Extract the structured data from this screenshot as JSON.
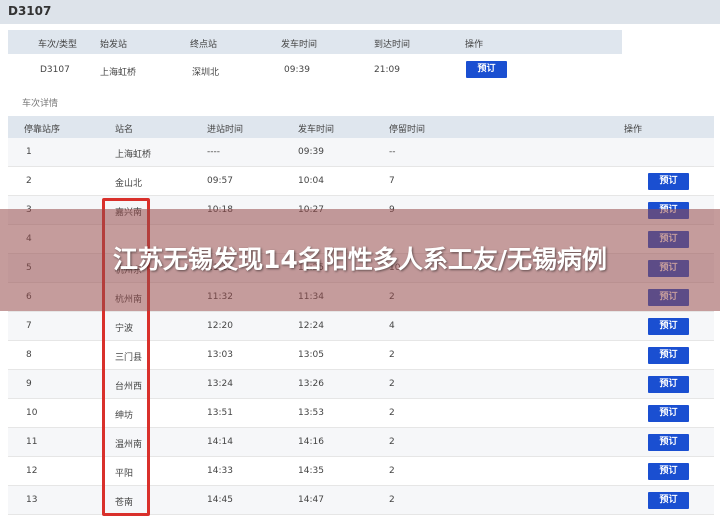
{
  "title": "D3107",
  "summary": {
    "headers": [
      "车次/类型",
      "始发站",
      "终点站",
      "发车时间",
      "到达时间",
      "操作"
    ],
    "row": {
      "train": "D3107",
      "from": "上海虹桥",
      "to": "深圳北",
      "depart": "09:39",
      "arrive": "21:09",
      "action": "预订"
    }
  },
  "section_title": "车次详情",
  "detail": {
    "headers": [
      "停靠站序",
      "站名",
      "进站时间",
      "发车时间",
      "停留时间",
      "操作"
    ],
    "rows": [
      {
        "seq": "1",
        "station": "上海虹桥",
        "arrive": "----",
        "depart": "09:39",
        "stay": "--",
        "action": ""
      },
      {
        "seq": "2",
        "station": "金山北",
        "arrive": "09:57",
        "depart": "10:04",
        "stay": "7",
        "action": "预订"
      },
      {
        "seq": "3",
        "station": "嘉兴南",
        "arrive": "10:18",
        "depart": "10:27",
        "stay": "9",
        "action": "预订"
      },
      {
        "seq": "4",
        "station": "",
        "arrive": "",
        "depart": "",
        "stay": "",
        "action": "预订"
      },
      {
        "seq": "5",
        "station": "杭州东",
        "arrive": "11:15",
        "depart": "11:25",
        "stay": "10",
        "action": "预订"
      },
      {
        "seq": "6",
        "station": "杭州南",
        "arrive": "11:32",
        "depart": "11:34",
        "stay": "2",
        "action": "预订"
      },
      {
        "seq": "7",
        "station": "宁波",
        "arrive": "12:20",
        "depart": "12:24",
        "stay": "4",
        "action": "预订"
      },
      {
        "seq": "8",
        "station": "三门县",
        "arrive": "13:03",
        "depart": "13:05",
        "stay": "2",
        "action": "预订"
      },
      {
        "seq": "9",
        "station": "台州西",
        "arrive": "13:24",
        "depart": "13:26",
        "stay": "2",
        "action": "预订"
      },
      {
        "seq": "10",
        "station": "绅坊",
        "arrive": "13:51",
        "depart": "13:53",
        "stay": "2",
        "action": "预订"
      },
      {
        "seq": "11",
        "station": "温州南",
        "arrive": "14:14",
        "depart": "14:16",
        "stay": "2",
        "action": "预订"
      },
      {
        "seq": "12",
        "station": "平阳",
        "arrive": "14:33",
        "depart": "14:35",
        "stay": "2",
        "action": "预订"
      },
      {
        "seq": "13",
        "station": "苍南",
        "arrive": "14:45",
        "depart": "14:47",
        "stay": "2",
        "action": "预订"
      }
    ]
  },
  "overlay_text": "江苏无锡发现14名阳性多人系工友/无锡病例",
  "colors": {
    "accent": "#1a4fd1",
    "highlight": "#d9302b",
    "header_bg": "#dfe6ee"
  }
}
